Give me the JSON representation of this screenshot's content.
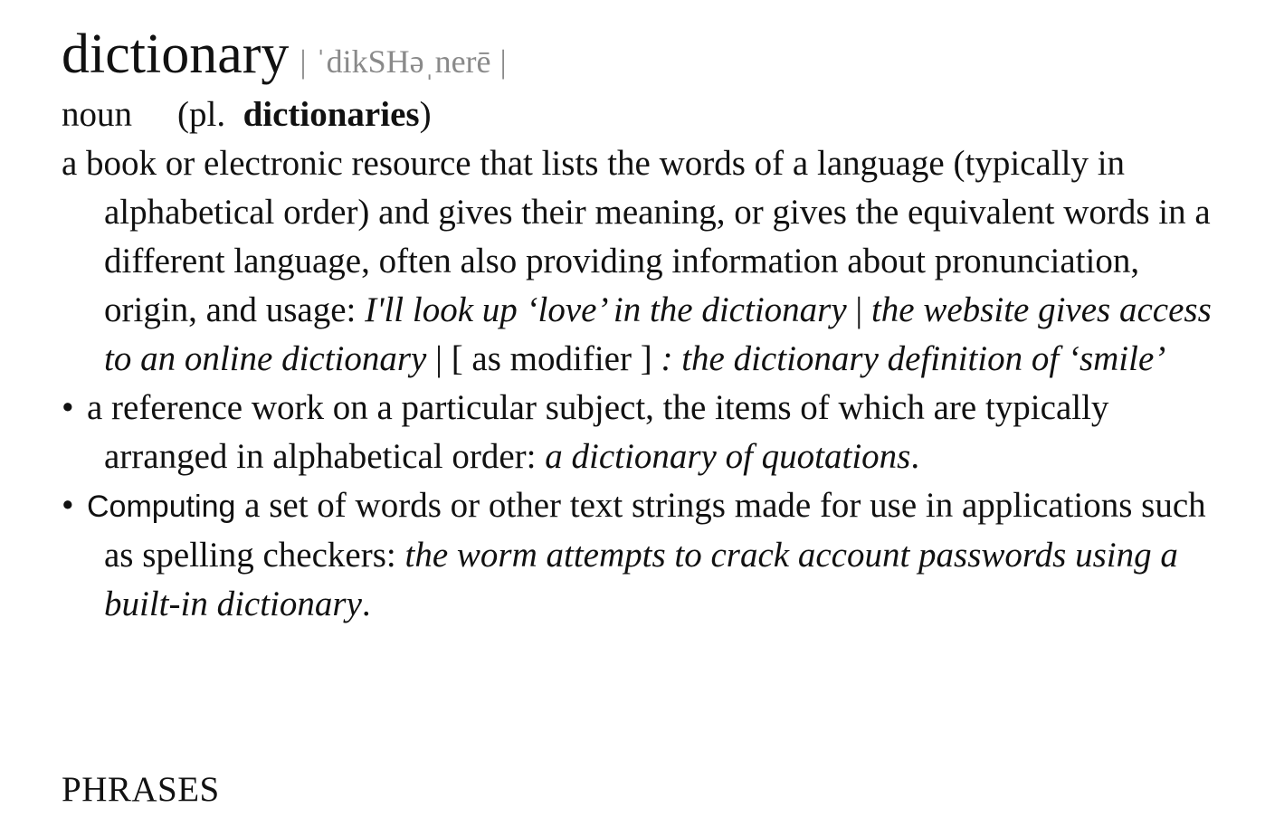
{
  "headword": "dictionary",
  "pronunciation": {
    "bar_open": "|",
    "ipa": "ˈdikSHəˌnerē",
    "bar_close": "|"
  },
  "grammar": {
    "pos": "noun",
    "plural_prefix": "(pl.",
    "plural": "dictionaries",
    "plural_suffix": ")"
  },
  "senses": [
    {
      "definition": "a book or electronic resource that lists the words of a language (typically in alphabetical order) and gives their meaning, or gives the equivalent words in a different language, often also providing information about pronunciation, origin, and usage:",
      "example_1": "I'll look up ‘love’ in the dictionary",
      "separator_1": "|",
      "example_2": "the website gives access to an online dictionary",
      "separator_2": "|",
      "modifier_label": "[ as modifier ]",
      "example_3": ": the dictionary definition of ‘smile’"
    },
    {
      "bullet": "•",
      "definition": "a reference work on a particular subject, the items of which are typically arranged in alphabetical order:",
      "example": "a dictionary of quotations",
      "end": "."
    },
    {
      "bullet": "•",
      "domain": "Computing",
      "definition": "a set of words or other text strings made for use in applications such as spelling checkers:",
      "example": "the worm attempts to crack account passwords using a built-in dictionary",
      "end": "."
    }
  ],
  "phrases_heading": "PHRASES"
}
